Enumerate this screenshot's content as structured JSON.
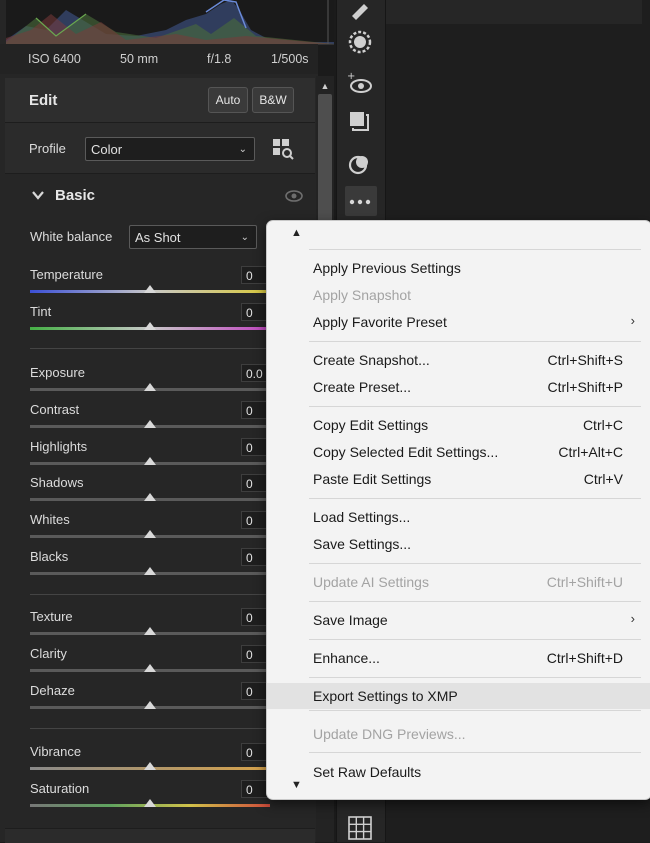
{
  "exif": {
    "iso": "ISO 6400",
    "focal_length": "50 mm",
    "aperture": "f/1.8",
    "shutter": "1/500s"
  },
  "edit": {
    "title": "Edit",
    "auto_label": "Auto",
    "bw_label": "B&W"
  },
  "profile": {
    "label": "Profile",
    "value": "Color"
  },
  "basic": {
    "title": "Basic",
    "white_balance": {
      "label": "White balance",
      "value": "As Shot"
    },
    "sliders": [
      {
        "label": "Temperature",
        "value": "0",
        "position": 0.5
      },
      {
        "label": "Tint",
        "value": "0",
        "position": 0.5
      },
      {
        "label": "Exposure",
        "value": "0.0",
        "position": 0.5
      },
      {
        "label": "Contrast",
        "value": "0",
        "position": 0.5
      },
      {
        "label": "Highlights",
        "value": "0",
        "position": 0.5
      },
      {
        "label": "Shadows",
        "value": "0",
        "position": 0.5
      },
      {
        "label": "Whites",
        "value": "0",
        "position": 0.5
      },
      {
        "label": "Blacks",
        "value": "0",
        "position": 0.5
      },
      {
        "label": "Texture",
        "value": "0",
        "position": 0.5
      },
      {
        "label": "Clarity",
        "value": "0",
        "position": 0.5
      },
      {
        "label": "Dehaze",
        "value": "0",
        "position": 0.5
      },
      {
        "label": "Vibrance",
        "value": "0",
        "position": 0.5
      },
      {
        "label": "Saturation",
        "value": "0",
        "position": 0.5
      }
    ]
  },
  "context_menu": {
    "items": [
      {
        "label": "Apply Previous Settings",
        "shortcut": "",
        "disabled": false,
        "submenu": false
      },
      {
        "label": "Apply Snapshot",
        "shortcut": "",
        "disabled": true,
        "submenu": false
      },
      {
        "label": "Apply Favorite Preset",
        "shortcut": "",
        "disabled": false,
        "submenu": true
      },
      {
        "label": "Create Snapshot...",
        "shortcut": "Ctrl+Shift+S",
        "disabled": false,
        "submenu": false
      },
      {
        "label": "Create Preset...",
        "shortcut": "Ctrl+Shift+P",
        "disabled": false,
        "submenu": false
      },
      {
        "label": "Copy Edit Settings",
        "shortcut": "Ctrl+C",
        "disabled": false,
        "submenu": false
      },
      {
        "label": "Copy Selected Edit Settings...",
        "shortcut": "Ctrl+Alt+C",
        "disabled": false,
        "submenu": false
      },
      {
        "label": "Paste Edit Settings",
        "shortcut": "Ctrl+V",
        "disabled": false,
        "submenu": false
      },
      {
        "label": "Load Settings...",
        "shortcut": "",
        "disabled": false,
        "submenu": false
      },
      {
        "label": "Save Settings...",
        "shortcut": "",
        "disabled": false,
        "submenu": false
      },
      {
        "label": "Update AI Settings",
        "shortcut": "Ctrl+Shift+U",
        "disabled": true,
        "submenu": false
      },
      {
        "label": "Save Image",
        "shortcut": "",
        "disabled": false,
        "submenu": true
      },
      {
        "label": "Enhance...",
        "shortcut": "Ctrl+Shift+D",
        "disabled": false,
        "submenu": false
      },
      {
        "label": "Export Settings to XMP",
        "shortcut": "",
        "disabled": false,
        "submenu": false
      },
      {
        "label": "Update DNG Previews...",
        "shortcut": "",
        "disabled": true,
        "submenu": false
      },
      {
        "label": "Set Raw Defaults",
        "shortcut": "",
        "disabled": false,
        "submenu": false
      }
    ]
  },
  "colors": {
    "panel_bg": "#262626",
    "menu_bg": "#f3f3f3",
    "disabled_text": "#a3a3a3"
  },
  "icons": [
    "brush-icon",
    "radial-filter-icon",
    "red-eye-icon",
    "snapshots-icon",
    "presets-icon",
    "more-icon",
    "grid-icon",
    "eye-icon",
    "browse-profiles-icon"
  ]
}
